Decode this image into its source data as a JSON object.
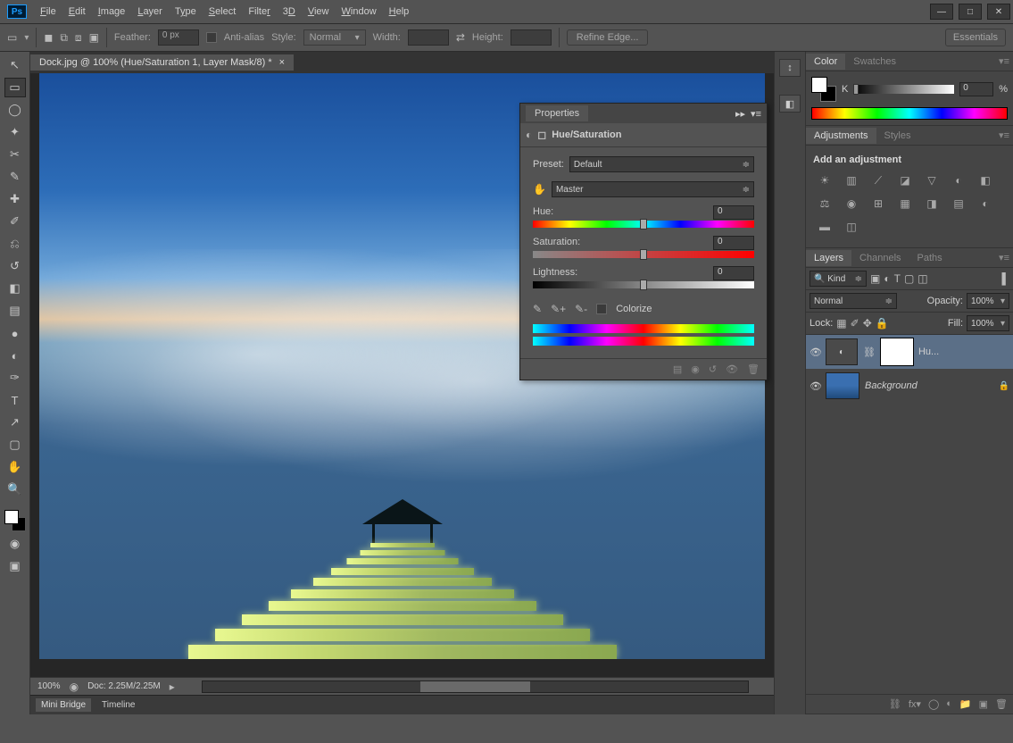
{
  "app_name": "Ps",
  "menubar": [
    "File",
    "Edit",
    "Image",
    "Layer",
    "Type",
    "Select",
    "Filter",
    "3D",
    "View",
    "Window",
    "Help"
  ],
  "optionsbar": {
    "feather_label": "Feather:",
    "feather_value": "0 px",
    "antialias": "Anti-alias",
    "style_label": "Style:",
    "style_value": "Normal",
    "width_label": "Width:",
    "height_label": "Height:",
    "refine_edge": "Refine Edge...",
    "workspace": "Essentials"
  },
  "document": {
    "tab_title": "Dock.jpg @ 100% (Hue/Saturation 1, Layer Mask/8) *",
    "zoom": "100%",
    "doc_size": "Doc: 2.25M/2.25M"
  },
  "bottom_tabs": [
    "Mini Bridge",
    "Timeline"
  ],
  "properties": {
    "title": "Properties",
    "type": "Hue/Saturation",
    "preset_label": "Preset:",
    "preset_value": "Default",
    "channel_value": "Master",
    "hue_label": "Hue:",
    "hue_value": "0",
    "sat_label": "Saturation:",
    "sat_value": "0",
    "lig_label": "Lightness:",
    "lig_value": "0",
    "colorize": "Colorize"
  },
  "color_panel": {
    "tabs": [
      "Color",
      "Swatches"
    ],
    "channel": "K",
    "value": "0",
    "unit": "%"
  },
  "adjustments_panel": {
    "tabs": [
      "Adjustments",
      "Styles"
    ],
    "prompt": "Add an adjustment"
  },
  "layers_panel": {
    "tabs": [
      "Layers",
      "Channels",
      "Paths"
    ],
    "filter_kind": "Kind",
    "blend_mode": "Normal",
    "opacity_label": "Opacity:",
    "opacity_value": "100%",
    "lock_label": "Lock:",
    "fill_label": "Fill:",
    "fill_value": "100%",
    "layers": [
      {
        "name": "Hu...",
        "type": "adjustment"
      },
      {
        "name": "Background",
        "type": "image",
        "locked": true
      }
    ]
  }
}
